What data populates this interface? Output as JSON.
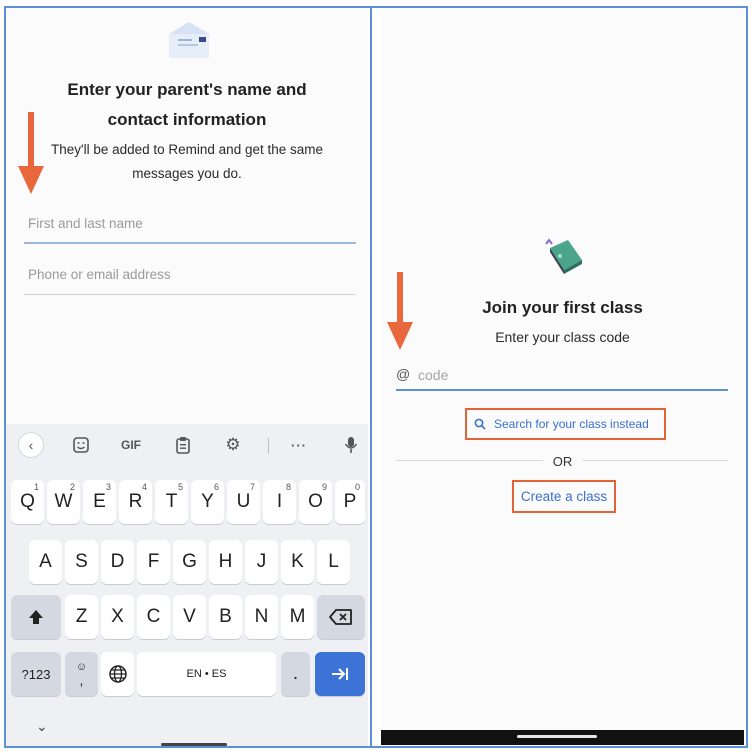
{
  "left_screen": {
    "title_line1": "Enter your parent's name and",
    "title_line2": "contact information",
    "subtitle_line1": "They'll be added to Remind and get the same",
    "subtitle_line2": "messages you do.",
    "name_field": {
      "placeholder": "First and last name",
      "value": ""
    },
    "contact_field": {
      "placeholder": "Phone or email address",
      "value": ""
    },
    "annotation_arrow_color": "#e8673c"
  },
  "keyboard": {
    "toolbar": {
      "back_icon": "chevron-left-icon",
      "emoji_icon": "sticker-icon",
      "gif_label": "GIF",
      "clipboard_icon": "clipboard-icon",
      "settings_icon": "gear-icon",
      "more_label": "···",
      "mic_icon": "microphone-icon"
    },
    "row1": [
      {
        "label": "Q",
        "hint": "1"
      },
      {
        "label": "W",
        "hint": "2"
      },
      {
        "label": "E",
        "hint": "3"
      },
      {
        "label": "R",
        "hint": "4"
      },
      {
        "label": "T",
        "hint": "5"
      },
      {
        "label": "Y",
        "hint": "6"
      },
      {
        "label": "U",
        "hint": "7"
      },
      {
        "label": "I",
        "hint": "8"
      },
      {
        "label": "O",
        "hint": "9"
      },
      {
        "label": "P",
        "hint": "0"
      }
    ],
    "row2": [
      "A",
      "S",
      "D",
      "F",
      "G",
      "H",
      "J",
      "K",
      "L"
    ],
    "row3": [
      "Z",
      "X",
      "C",
      "V",
      "B",
      "N",
      "M"
    ],
    "symbols_label": "?123",
    "comma_label": ",",
    "space_label": "EN • ES",
    "period_label": ".",
    "enter_icon": "tab-arrow-icon",
    "shift_icon": "shift-icon",
    "backspace_icon": "backspace-icon",
    "globe_icon": "globe-icon",
    "hide_icon": "chevron-down-icon",
    "accent_color": "#3d72d6"
  },
  "right_screen": {
    "title": "Join your first class",
    "subtitle": "Enter your class code",
    "code_prefix": "@",
    "code_field": {
      "placeholder": "code",
      "value": ""
    },
    "search_link": "Search for your class instead",
    "or_label": "OR",
    "create_link": "Create a class",
    "highlight_color": "#e0663a",
    "link_color": "#3b6fd1"
  }
}
